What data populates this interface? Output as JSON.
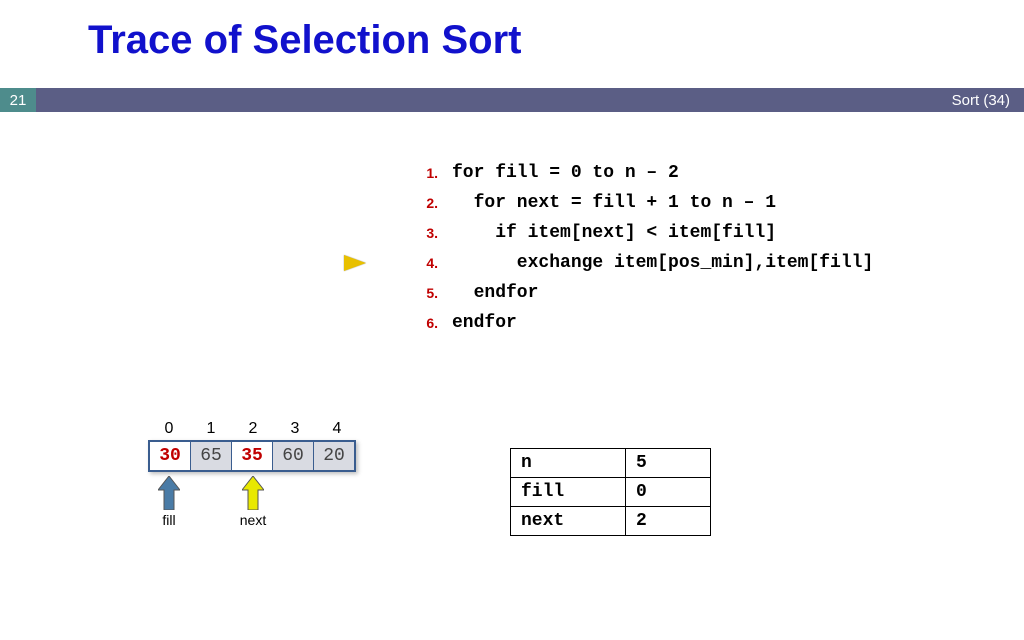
{
  "title": "Trace of Selection Sort",
  "slide_number": "21",
  "bar_right": "Sort (34)",
  "current_line_index": 3,
  "code": {
    "lines": [
      {
        "n": "1.",
        "text": "for fill = 0 to n – 2"
      },
      {
        "n": "2.",
        "text": "  for next = fill + 1 to n – 1"
      },
      {
        "n": "3.",
        "text": "    if item[next] < item[fill]"
      },
      {
        "n": "4.",
        "text": "      exchange item[pos_min],item[fill]"
      },
      {
        "n": "5.",
        "text": "  endfor"
      },
      {
        "n": "6.",
        "text": "endfor"
      }
    ]
  },
  "array": {
    "indices": [
      "0",
      "1",
      "2",
      "3",
      "4"
    ],
    "cells": [
      {
        "v": "30",
        "hi": true
      },
      {
        "v": "65",
        "hi": false
      },
      {
        "v": "35",
        "hi": true
      },
      {
        "v": "60",
        "hi": false
      },
      {
        "v": "20",
        "hi": false
      }
    ],
    "pointers": {
      "fill": {
        "label": "fill",
        "at": 0,
        "color": "#4a7ba6"
      },
      "next": {
        "label": "next",
        "at": 2,
        "color": "#e8e800"
      }
    }
  },
  "state": [
    {
      "k": "n",
      "v": "5"
    },
    {
      "k": "fill",
      "v": "0"
    },
    {
      "k": "next",
      "v": "2"
    }
  ]
}
